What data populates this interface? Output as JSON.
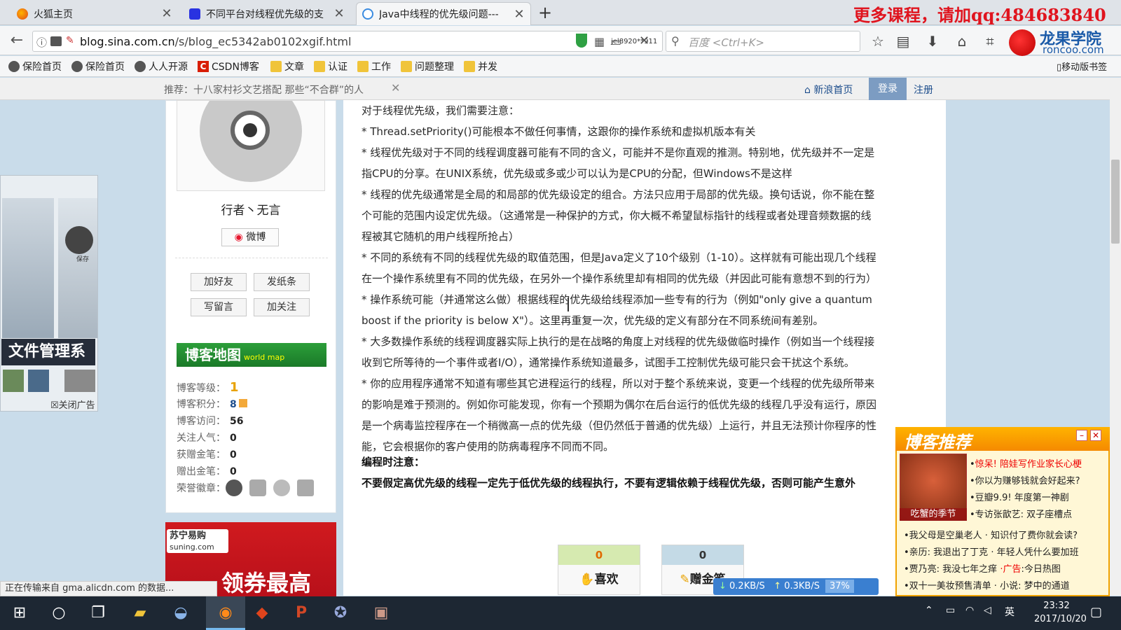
{
  "tabs": [
    {
      "title": "火狐主页",
      "icon": "firefox-icon"
    },
    {
      "title": "不同平台对线程优先级的支",
      "icon": "paw-icon"
    },
    {
      "title": "Java中线程的优先级问题---",
      "icon": "loading-icon"
    }
  ],
  "promo_banner": "更多课程，请加qq:484683840",
  "address": {
    "prefix": "blog.sina.com.cn",
    "path": "/s/blog_ec5342ab0102xgif.html"
  },
  "overlay_user": "jel8920**911",
  "search_placeholder": "百度 <Ctrl+K>",
  "logo": {
    "cn": "龙果学院",
    "en": "roncoo.com"
  },
  "bookmarks": [
    {
      "label": "保险首页",
      "icon": "globe-icon"
    },
    {
      "label": "保险首页",
      "icon": "globe-icon"
    },
    {
      "label": "人人开源",
      "icon": "globe-icon"
    },
    {
      "label": "CSDN博客",
      "icon": "csdn-icon"
    },
    {
      "label": "文章",
      "icon": "folder-icon"
    },
    {
      "label": "认证",
      "icon": "folder-icon"
    },
    {
      "label": "工作",
      "icon": "folder-icon"
    },
    {
      "label": "问题整理",
      "icon": "folder-icon"
    },
    {
      "label": "并发",
      "icon": "folder-icon"
    }
  ],
  "mobile_bookmarks": "移动版书签",
  "sina_bar": {
    "recommend": "推荐：十八家村衫文艺搭配  那些“不合群”的人",
    "home": "新浪首页",
    "login": "登录",
    "register": "注册"
  },
  "left_ad": {
    "title": "文件管理系",
    "close": "☒关闭广告",
    "label": "保存"
  },
  "profile": {
    "name": "行者丶无言",
    "weibo": "微博",
    "buttons": [
      "加好友",
      "发纸条",
      "写留言",
      "加关注"
    ],
    "blogmap": "博客地图",
    "blogmap_sub": "world map",
    "stats": [
      {
        "label": "博客等级：",
        "value": "1"
      },
      {
        "label": "博客积分：",
        "value": "8"
      },
      {
        "label": "博客访问：",
        "value": "56"
      },
      {
        "label": "关注人气：",
        "value": "0"
      },
      {
        "label": "获赠金笔：",
        "value": "0"
      },
      {
        "label": "赠出金笔：",
        "value": "0"
      },
      {
        "label": "荣誉徽章：",
        "value": ""
      }
    ]
  },
  "suning_ad": {
    "logo1": "苏宁易购",
    "logo2": "suning.com",
    "text": "领券最高"
  },
  "article_lines": [
    "对于线程优先级，我们需要注意：",
    "* Thread.setPriority()可能根本不做任何事情，这跟你的操作系统和虚拟机版本有关",
    "* 线程优先级对于不同的线程调度器可能有不同的含义，可能并不是你直观的推测。特别地，优先级并不一定是",
    "指CPU的分享。在UNIX系统，优先级或多或少可以认为是CPU的分配，但Windows不是这样",
    "* 线程的优先级通常是全局的和局部的优先级设定的组合。方法只应用于局部的优先级。换句话说，你不能在整",
    "个可能的范围内设定优先级。（这通常是一种保护的方式，你大概不希望鼠标指针的线程或者处理音频数据的线",
    "程被其它随机的用户线程所抢占）",
    "* 不同的系统有不同的线程优先级的取值范围，但是Java定义了10个级别（1-10）。这样就有可能出现几个线程",
    "在一个操作系统里有不同的优先级，在另外一个操作系统里却有相同的优先级（并因此可能有意想不到的行为）",
    "* 操作系统可能（并通常这么做）根据线程的优先级给线程添加一些专有的行为（例如\"only give a quantum",
    "boost if the priority is below X\"）。这里再重复一次，优先级的定义有部分在不同系统间有差别。",
    "* 大多数操作系统的线程调度器实际上执行的是在战略的角度上对线程的优先级做临时操作（例如当一个线程接",
    "收到它所等待的一个事件或者I/O），通常操作系统知道最多，试图手工控制优先级可能只会干扰这个系统。",
    "* 你的应用程序通常不知道有哪些其它进程运行的线程，所以对于整个系统来说，变更一个线程的优先级所带来",
    "的影响是难于预测的。例如你可能发现，你有一个预期为偶尔在后台运行的低优先级的线程几乎没有运行，原因",
    "是一个病毒监控程序在一个稍微高一点的优先级（但仍然低于普通的优先级）上运行，并且无法预计你程序的性",
    "能，它会根据你的客户使用的防病毒程序不同而不同。"
  ],
  "article_heading": "编程时注意：",
  "article_bold": "不要假定高优先级的线程一定先于低优先级的线程执行，不要有逻辑依赖于线程优先级，否则可能产生意外",
  "like": {
    "count": "0",
    "label": "喜欢"
  },
  "gift": {
    "count": "0",
    "label": "赠金笔"
  },
  "blog_recommend": {
    "title": "博客推荐",
    "image_caption": "吃蟹的季节",
    "items_top": [
      {
        "bullet": "•",
        "hl": "惊呆!",
        "text": " 陪娃写作业家长心梗",
        "hl_red": true
      },
      {
        "bullet": "•",
        "hl": "",
        "text": "你以为赚够钱就会好起来?"
      },
      {
        "bullet": "•",
        "hl": "",
        "text": "豆瓣9.9! 年度第一神剧"
      },
      {
        "bullet": "•",
        "hl": "",
        "text": "专访张歆艺: 双子座槽点"
      }
    ],
    "items_bottom": [
      "•我父母是空巢老人 · 知识付了费你就会读?",
      "•亲历: 我退出了丁克 · 年轻人凭什么要加班",
      "•贾乃亮: 我没七年之痒",
      "•双十一美妆预售清单 · 小说: 梦中的通道"
    ],
    "ad_label": "·广告",
    "ad_text": ":今日热图"
  },
  "download": {
    "down": "0.2KB/S",
    "up": "0.3KB/S",
    "pct": "37%"
  },
  "status_text": "正在传输来自 gma.alicdn.com 的数据...",
  "clock": {
    "time": "23:32",
    "date": "2017/10/20"
  },
  "tray_lang": "英"
}
